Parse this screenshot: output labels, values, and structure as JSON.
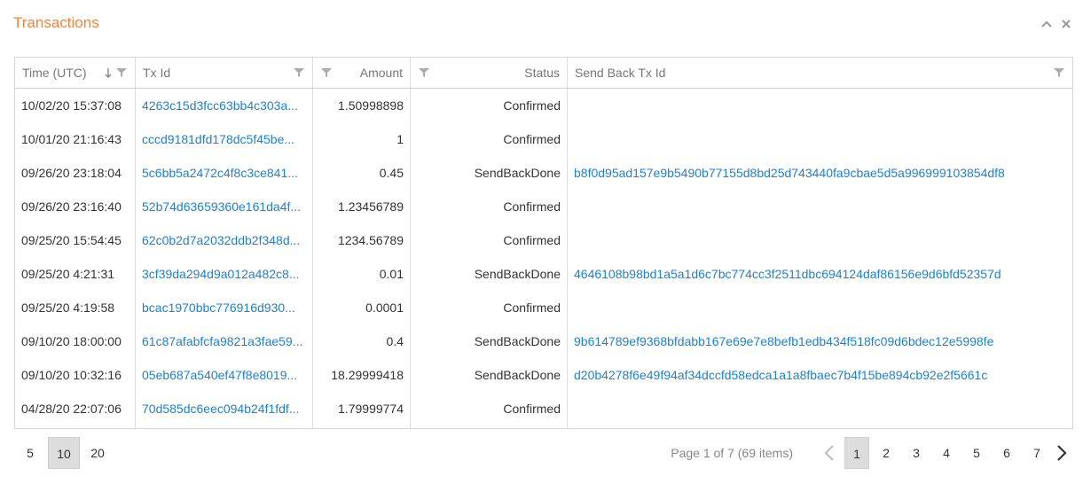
{
  "panel": {
    "title": "Transactions",
    "collapse_icon": "chevron-up-icon",
    "close_icon": "close-icon"
  },
  "columns": [
    {
      "label": "Time (UTC)",
      "sort": "desc"
    },
    {
      "label": "Tx Id"
    },
    {
      "label": "Amount"
    },
    {
      "label": "Status"
    },
    {
      "label": "Send Back Tx Id"
    }
  ],
  "rows": [
    {
      "time": "10/02/20 15:37:08",
      "txid": "4263c15d3fcc63bb4c303a...",
      "amount": "1.50998898",
      "status": "Confirmed",
      "sendback": ""
    },
    {
      "time": "10/01/20 21:16:43",
      "txid": "cccd9181dfd178dc5f45be...",
      "amount": "1",
      "status": "Confirmed",
      "sendback": ""
    },
    {
      "time": "09/26/20 23:18:04",
      "txid": "5c6bb5a2472c4f8c3ce841...",
      "amount": "0.45",
      "status": "SendBackDone",
      "sendback": "b8f0d95ad157e9b5490b77155d8bd25d743440fa9cbae5d5a996999103854df8"
    },
    {
      "time": "09/26/20 23:16:40",
      "txid": "52b74d63659360e161da4f...",
      "amount": "1.23456789",
      "status": "Confirmed",
      "sendback": ""
    },
    {
      "time": "09/25/20 15:54:45",
      "txid": "62c0b2d7a2032ddb2f348d...",
      "amount": "1234.56789",
      "status": "Confirmed",
      "sendback": ""
    },
    {
      "time": "09/25/20 4:21:31",
      "txid": "3cf39da294d9a012a482c8...",
      "amount": "0.01",
      "status": "SendBackDone",
      "sendback": "4646108b98bd1a5a1d6c7bc774cc3f2511dbc694124daf86156e9d6bfd52357d"
    },
    {
      "time": "09/25/20 4:19:58",
      "txid": "bcac1970bbc776916d930...",
      "amount": "0.0001",
      "status": "Confirmed",
      "sendback": ""
    },
    {
      "time": "09/10/20 18:00:00",
      "txid": "61c87afabfcfa9821a3fae59...",
      "amount": "0.4",
      "status": "SendBackDone",
      "sendback": "9b614789ef9368bfdabb167e69e7e8befb1edb434f518fc09d6bdec12e5998fe"
    },
    {
      "time": "09/10/20 10:32:16",
      "txid": "05eb687a540ef47f8e8019...",
      "amount": "18.29999418",
      "status": "SendBackDone",
      "sendback": "d20b4278f6e49f94af34dccfd58edca1a1a8fbaec7b4f15be894cb92e2f5661c"
    },
    {
      "time": "04/28/20 22:07:06",
      "txid": "70d585dc6eec094b24f1fdf...",
      "amount": "1.79999774",
      "status": "Confirmed",
      "sendback": ""
    }
  ],
  "pager": {
    "sizes": [
      "5",
      "10",
      "20"
    ],
    "active_size": "10",
    "info": "Page 1 of 7 (69 items)",
    "pages": [
      "1",
      "2",
      "3",
      "4",
      "5",
      "6",
      "7"
    ],
    "active_page": "1"
  },
  "colors": {
    "title": "#f0843c",
    "link": "#1a82d6",
    "active_bg": "#dcdcdc"
  }
}
